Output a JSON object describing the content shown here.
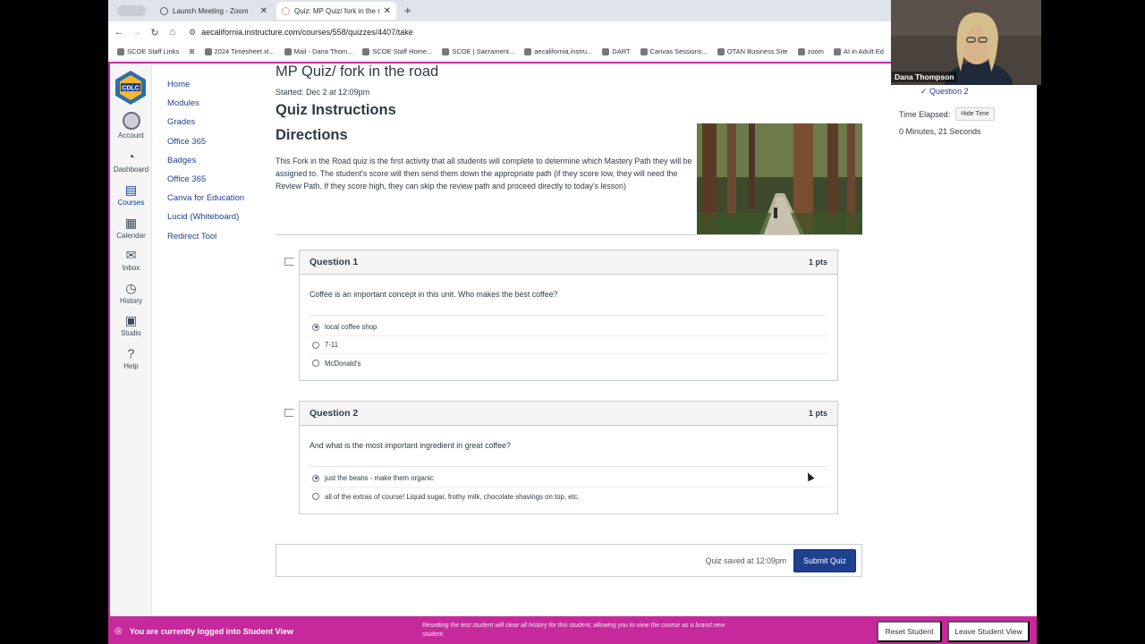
{
  "browser": {
    "tabs": [
      {
        "label": "Launch Meeting - Zoom",
        "active": false
      },
      {
        "label": "Quiz: MP Quiz/ fork in the roa",
        "active": true
      }
    ],
    "url": "aecalifornia.instructure.com/courses/558/quizzes/4407/take",
    "bookmarks": [
      "SCOE Staff Links",
      "2024 Timesheet.xl...",
      "Mail - Dana Thom...",
      "SCOE Staff Home...",
      "SCOE | Sacrament...",
      "aecalifornia.instru...",
      "DART",
      "Canvas Sessions...",
      "OTAN Business Site",
      "zoom",
      "AI in Adult Ed"
    ]
  },
  "global_nav": {
    "items": [
      {
        "label": "Account",
        "icon": "account-icon"
      },
      {
        "label": "Dashboard",
        "icon": "dashboard-icon"
      },
      {
        "label": "Courses",
        "icon": "courses-icon",
        "active": true
      },
      {
        "label": "Calendar",
        "icon": "calendar-icon"
      },
      {
        "label": "Inbox",
        "icon": "inbox-icon"
      },
      {
        "label": "History",
        "icon": "history-icon"
      },
      {
        "label": "Studio",
        "icon": "studio-icon"
      },
      {
        "label": "Help",
        "icon": "help-icon"
      }
    ]
  },
  "course_nav": [
    "Home",
    "Modules",
    "Grades",
    "Office 365",
    "Badges",
    "Office 365",
    "Canva for Education",
    "Lucid (Whiteboard)",
    "Redirect Tool"
  ],
  "quiz": {
    "title": "MP Quiz/ fork in the road",
    "started": "Started: Dec 2 at 12:09pm",
    "instructions_heading": "Quiz Instructions",
    "directions_heading": "Directions",
    "description": "This Fork in the Road quiz is the first activity that all students will complete to determine which Mastery Path they will be assigned to. The student's score will then send them down the appropriate path (if they score low, they will need the Review Path. If they score high, they can skip the review path and proceed directly to today's lesson)",
    "questions": [
      {
        "name": "Question 1",
        "points": "1 pts",
        "text": "Coffee is an important concept in this unit. Who makes the best coffee?",
        "answers": [
          {
            "label": "local coffee shop",
            "selected": true
          },
          {
            "label": "7-11",
            "selected": false
          },
          {
            "label": "McDonald's",
            "selected": false
          }
        ]
      },
      {
        "name": "Question 2",
        "points": "1 pts",
        "text": "And what is the most important ingredient in great coffee?",
        "answers": [
          {
            "label": "just the beans - make them organic",
            "selected": true
          },
          {
            "label": "all of the extras of course! Liquid sugar, frothy milk, chocolate shavings on top, etc.",
            "selected": false
          }
        ]
      }
    ],
    "saved_text": "Quiz saved at 12:09pm",
    "submit_label": "Submit Quiz"
  },
  "sidebar": {
    "question_link": "Question 2",
    "time_label": "Time Elapsed:",
    "hide_time_label": "Hide Time",
    "elapsed": "0 Minutes, 21 Seconds"
  },
  "student_view": {
    "message": "You are currently logged into Student View",
    "note": "Resetting the test student will clear all history for this student, allowing you to view the course as a brand new student.",
    "reset_label": "Reset Student",
    "leave_label": "Leave Student View"
  },
  "zoom": {
    "participant_name": "Dana Thompson"
  },
  "colors": {
    "accent": "#c6299b",
    "link": "#1f3f8f",
    "submit": "#1f3f8f"
  }
}
